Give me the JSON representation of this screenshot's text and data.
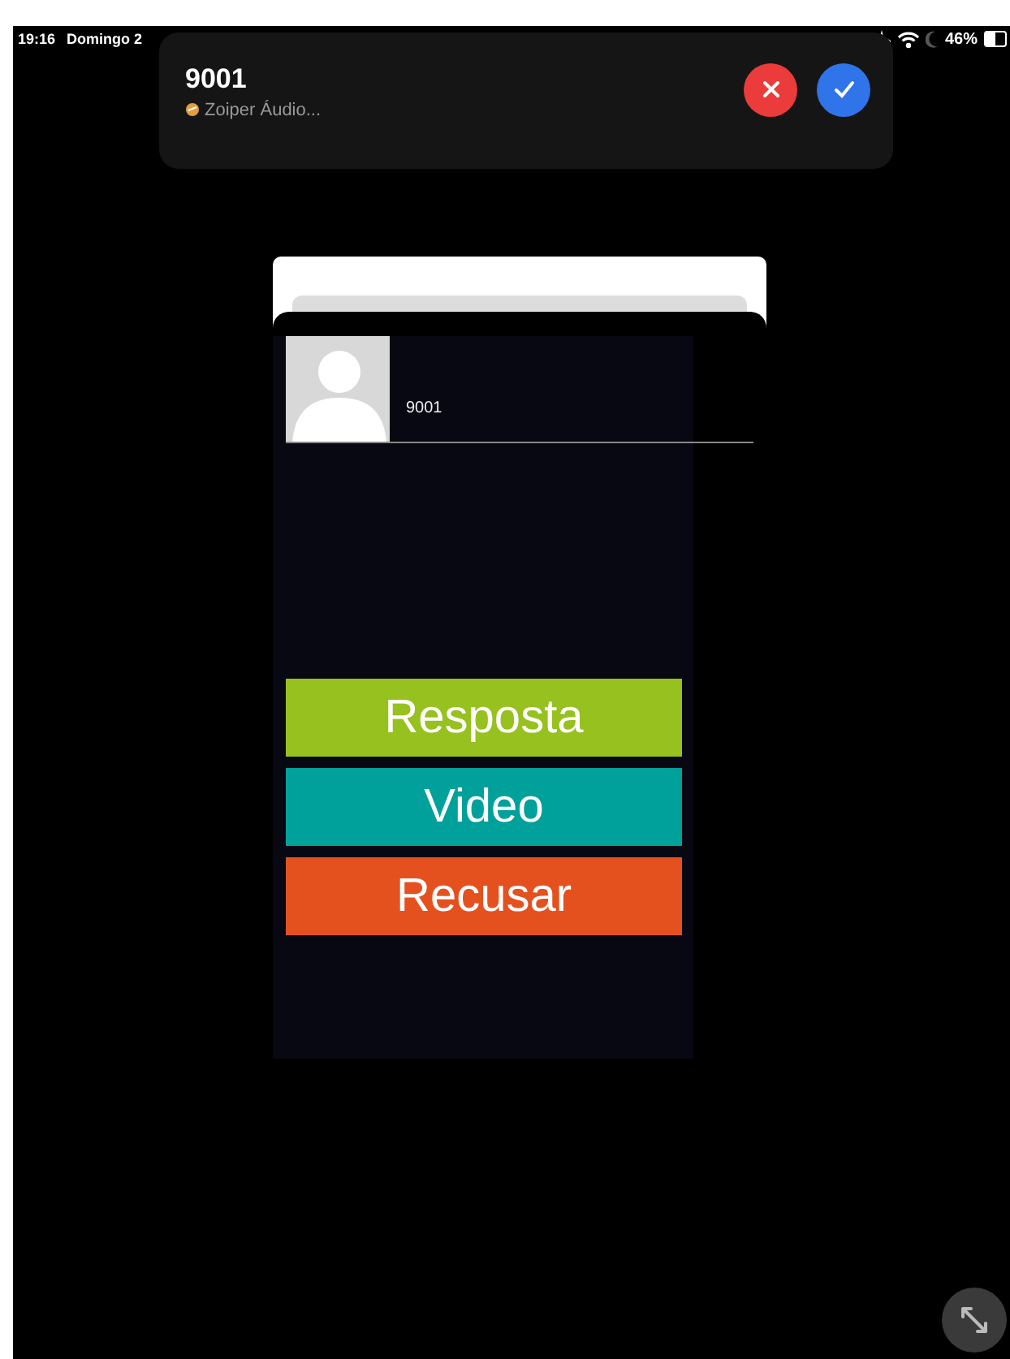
{
  "status_bar": {
    "time": "19:16",
    "date": "Domingo 2",
    "battery": "46%"
  },
  "notification": {
    "title": "9001",
    "subtitle": "Zoiper Áudio..."
  },
  "call": {
    "caller": "9001",
    "buttons": [
      {
        "label": "Resposta",
        "kind": "answer"
      },
      {
        "label": "Video",
        "kind": "video"
      },
      {
        "label": "Recusar",
        "kind": "decline"
      }
    ]
  }
}
